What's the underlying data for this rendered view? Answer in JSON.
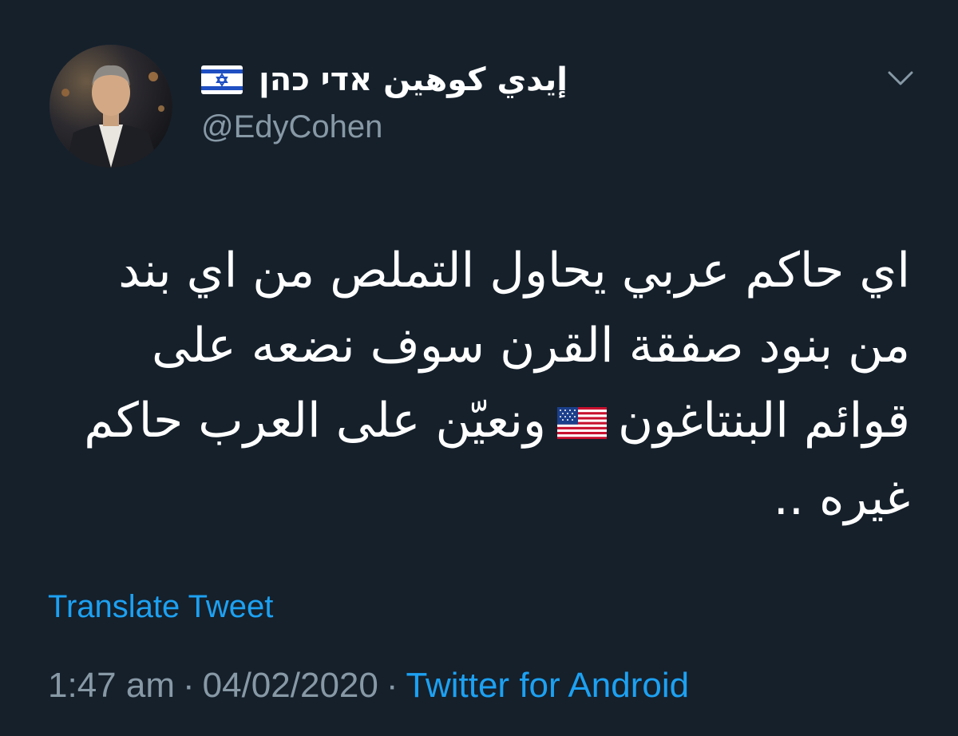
{
  "tweet": {
    "author": {
      "display_name": "إيدي كوهين אדי כהן",
      "handle": "@EdyCohen",
      "flag_icon": "israel-flag-icon"
    },
    "menu_icon": "chevron-down-icon",
    "text_lines": [
      "اي حاكم عربي يحاول التملص من اي بند",
      "من بنود صفقة القرن سوف نضعه على",
      {
        "before": "قوائم البنتاغون",
        "flag_icon": "us-flag-icon",
        "after": "ونعيّن على العرب حاكم"
      },
      "غيره .."
    ],
    "translate_label": "Translate Tweet",
    "time": "1:47 am",
    "separator": "·",
    "date": "04/02/2020",
    "source": "Twitter for Android"
  },
  "colors": {
    "background": "#15202b",
    "primary_text": "#ffffff",
    "secondary_text": "#8899a6",
    "link": "#1da1f2"
  }
}
